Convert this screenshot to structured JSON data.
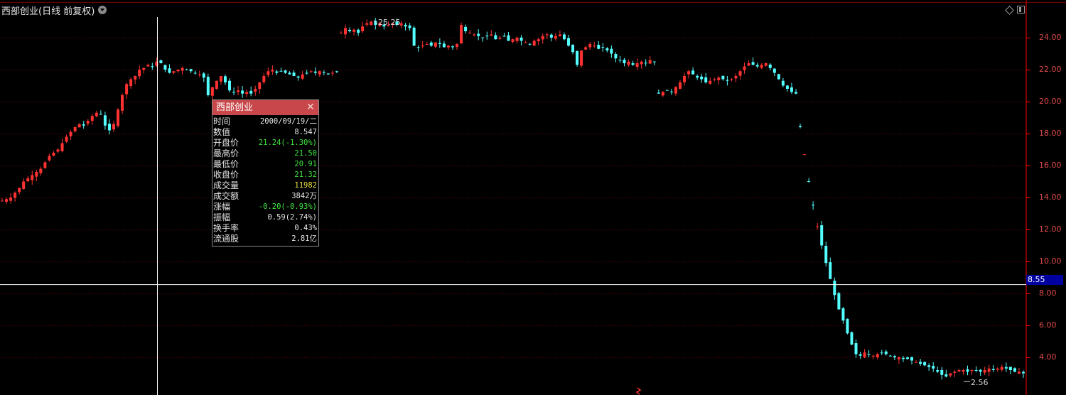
{
  "header": {
    "title": "西部创业(日线 前复权)"
  },
  "icons": {
    "dropdown": "chevron-down-icon",
    "diamond": "diamond-icon",
    "panel": "panel-icon"
  },
  "colors": {
    "up": "#ff3232",
    "down": "#54ffff",
    "grid": "#7a0000",
    "axis": "#ff0000",
    "cursor": "#ffffff"
  },
  "axis": {
    "current_price": "8.55"
  },
  "annotations": {
    "high": "25.25",
    "low": "2.56"
  },
  "popup": {
    "title": "西部创业",
    "rows": [
      {
        "label": "时间",
        "value": "2000/09/19/二",
        "color": "#e6e6e6"
      },
      {
        "label": "数值",
        "value": "8.547",
        "color": "#e6e6e6"
      },
      {
        "label": "开盘价",
        "value": "21.24(-1.30%)",
        "color": "#3ee43e"
      },
      {
        "label": "最高价",
        "value": "21.50",
        "color": "#3ee43e"
      },
      {
        "label": "最低价",
        "value": "20.91",
        "color": "#3ee43e"
      },
      {
        "label": "收盘价",
        "value": "21.32",
        "color": "#3ee43e"
      },
      {
        "label": "成交量",
        "value": "11982",
        "color": "#e8e040"
      },
      {
        "label": "成交额",
        "value": "3842万",
        "color": "#e6e6e6"
      },
      {
        "label": "涨幅",
        "value": "-0.20(-0.93%)",
        "color": "#3ee43e"
      },
      {
        "label": "振幅",
        "value": "0.59(2.74%)",
        "color": "#e6e6e6"
      },
      {
        "label": "换手率",
        "value": "0.43%",
        "color": "#e6e6e6"
      },
      {
        "label": "流通股",
        "value": "2.81亿",
        "color": "#e6e6e6"
      }
    ]
  },
  "chart_data": {
    "type": "candlestick",
    "title": "西部创业(日线 前复权)",
    "ylim": [
      2.6,
      25.5
    ],
    "yticks": [
      "24.00",
      "22.00",
      "20.00",
      "18.00",
      "16.00",
      "14.00",
      "12.00",
      "10.00",
      "8.00",
      "6.00",
      "4.00"
    ],
    "grid": true,
    "cursor_value": 8.55,
    "cursor_date": "2000/09/19",
    "max_label": 25.25,
    "min_label": 2.56,
    "close_series": [
      13.8,
      13.9,
      14.0,
      14.3,
      14.6,
      15.0,
      15.2,
      15.4,
      15.6,
      15.8,
      16.2,
      16.6,
      16.8,
      17.0,
      17.4,
      17.8,
      18.1,
      18.4,
      18.6,
      18.5,
      18.8,
      19.1,
      19.3,
      19.2,
      18.5,
      18.2,
      18.6,
      19.5,
      20.4,
      21.1,
      21.4,
      21.6,
      22.0,
      22.1,
      22.3,
      22.2,
      22.5,
      22.4,
      22.0,
      21.8,
      21.9,
      22.0,
      22.1,
      22.0,
      21.9,
      21.8,
      21.7,
      21.5,
      20.4,
      20.9,
      21.3,
      21.6,
      21.2,
      20.7,
      20.6,
      20.7,
      20.5,
      20.6,
      20.5,
      20.8,
      21.2,
      21.6,
      21.9,
      22.0,
      21.8,
      21.9,
      21.8,
      21.7,
      21.6,
      21.5,
      21.7,
      21.8,
      21.9,
      21.8,
      21.9,
      21.8,
      21.7,
      21.8,
      21.9,
      24.3,
      24.6,
      24.4,
      24.5,
      24.3,
      24.7,
      24.9,
      25.0,
      24.8,
      24.9,
      24.7,
      24.8,
      24.9,
      24.8,
      24.9,
      24.7,
      24.6,
      23.5,
      23.4,
      23.5,
      23.6,
      23.5,
      23.7,
      23.6,
      23.4,
      23.5,
      23.4,
      23.6,
      24.8,
      24.4,
      24.3,
      24.2,
      24.1,
      24.0,
      24.1,
      24.2,
      23.9,
      24.0,
      24.1,
      23.8,
      23.9,
      24.0,
      23.8,
      23.7,
      23.6,
      23.8,
      23.9,
      24.1,
      24.2,
      24.0,
      24.1,
      24.2,
      23.9,
      23.5,
      23.1,
      22.3,
      23.2,
      23.4,
      23.6,
      23.5,
      23.3,
      23.4,
      23.2,
      23.0,
      22.7,
      22.6,
      22.4,
      22.5,
      22.3,
      22.4,
      22.5,
      22.4,
      22.6,
      22.5,
      20.5,
      20.6,
      20.7,
      20.6,
      20.9,
      21.2,
      21.6,
      21.9,
      21.7,
      21.5,
      21.4,
      21.2,
      21.3,
      21.4,
      21.5,
      21.4,
      21.3,
      21.4,
      21.6,
      21.9,
      22.2,
      22.4,
      22.3,
      22.2,
      22.3,
      22.4,
      22.1,
      21.8,
      21.4,
      21.0,
      20.8,
      20.6,
      20.5,
      18.4,
      16.7,
      15.0,
      13.5,
      12.2,
      11.0,
      9.9,
      8.9,
      7.9,
      7.0,
      6.3,
      5.5,
      4.8,
      4.2,
      4.1,
      4.3,
      4.2,
      4.1,
      4.2,
      4.3,
      4.2,
      4.1,
      4.0,
      4.0,
      3.9,
      3.9,
      3.8,
      3.7,
      3.6,
      3.5,
      3.4,
      3.3,
      3.1,
      2.9,
      2.8,
      3.0,
      3.1,
      3.2,
      3.2,
      3.1,
      3.2,
      3.2,
      3.1,
      3.2,
      3.3,
      3.2,
      3.3,
      3.4,
      3.3,
      3.2,
      3.1,
      3.1,
      3.0
    ]
  }
}
